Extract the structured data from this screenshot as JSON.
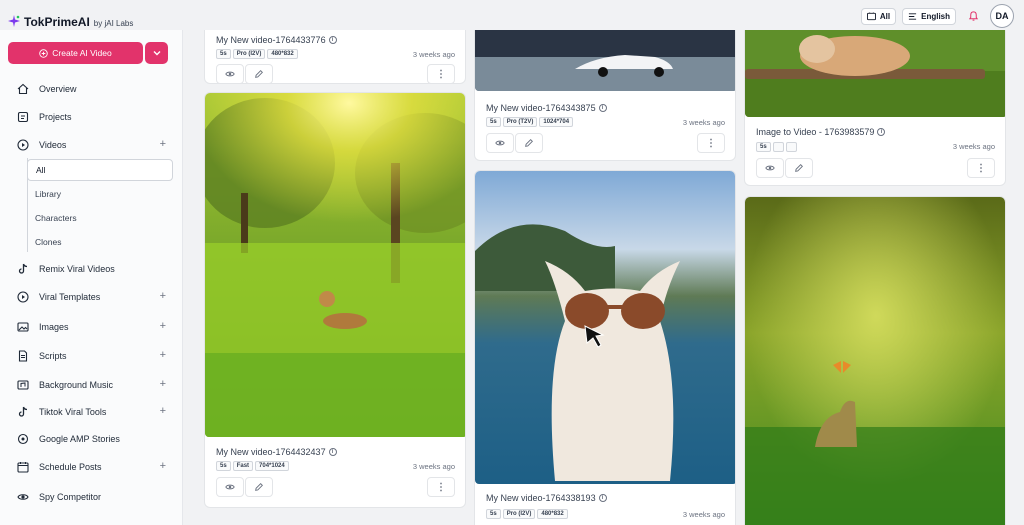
{
  "brand": {
    "name": "TokPrimeAI",
    "by": "by jAI Labs"
  },
  "header": {
    "filter_label": "All",
    "language_label": "English",
    "avatar_initials": "DA"
  },
  "sidebar": {
    "create_label": "Create AI Video",
    "items": [
      {
        "label": "Overview",
        "icon": "home-icon"
      },
      {
        "label": "Projects",
        "icon": "projects-icon"
      },
      {
        "label": "Videos",
        "icon": "play-circle-icon",
        "expand": "+"
      },
      {
        "label": "Remix Viral Videos",
        "icon": "tiktok-icon"
      },
      {
        "label": "Viral Templates",
        "icon": "play-circle-icon",
        "expand": "+"
      },
      {
        "label": "Images",
        "icon": "image-icon",
        "expand": "+"
      },
      {
        "label": "Scripts",
        "icon": "document-icon",
        "expand": "+"
      },
      {
        "label": "Background Music",
        "icon": "music-icon",
        "expand": "+"
      },
      {
        "label": "Tiktok Viral Tools",
        "icon": "tiktok-icon",
        "expand": "+"
      },
      {
        "label": "Google AMP Stories",
        "icon": "stories-icon"
      },
      {
        "label": "Schedule Posts",
        "icon": "calendar-icon",
        "expand": "+"
      },
      {
        "label": "Spy Competitor",
        "icon": "eye-icon"
      }
    ],
    "video_sub": [
      "All",
      "Library",
      "Characters",
      "Clones"
    ]
  },
  "videos": [
    {
      "title": "My New video-1764433776",
      "tags": [
        "5s",
        "Pro (I2V)",
        "480*832"
      ],
      "ago": "3 weeks ago"
    },
    {
      "title": "My New video-1764432437",
      "tags": [
        "5s",
        "Fast",
        "704*1024"
      ],
      "ago": "3 weeks ago"
    },
    {
      "title": "My New video-1764343875",
      "tags": [
        "5s",
        "Pro (T2V)",
        "1024*704"
      ],
      "ago": "3 weeks ago"
    },
    {
      "title": "My New video-1764338193",
      "tags": [
        "5s",
        "Pro (I2V)",
        "480*832"
      ],
      "ago": "3 weeks ago"
    },
    {
      "title": "Image to Video - 1763983579",
      "tags": [
        "5s"
      ],
      "ago": "3 weeks ago"
    }
  ],
  "colors": {
    "accent": "#e2336b",
    "bell": "#e2336b"
  }
}
